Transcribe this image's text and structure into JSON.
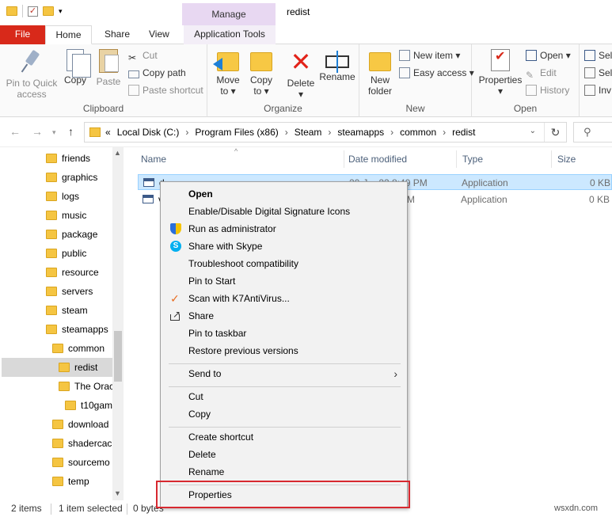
{
  "window": {
    "context_tab_header": "Manage",
    "title": "redist"
  },
  "tabs": {
    "file": "File",
    "home": "Home",
    "share": "Share",
    "view": "View",
    "app_tools": "Application Tools"
  },
  "ribbon": {
    "clipboard": {
      "label": "Clipboard",
      "pin_line1": "Pin to Quick",
      "pin_line2": "access",
      "copy": "Copy",
      "paste": "Paste",
      "cut": "Cut",
      "copy_path": "Copy path",
      "paste_shortcut": "Paste shortcut"
    },
    "organize": {
      "label": "Organize",
      "move_to_line1": "Move",
      "move_to_line2": "to ▾",
      "copy_to_line1": "Copy",
      "copy_to_line2": "to ▾",
      "delete_line1": "Delete",
      "delete_line2": "▾",
      "rename": "Rename"
    },
    "new": {
      "label": "New",
      "new_folder_line1": "New",
      "new_folder_line2": "folder",
      "new_item": "New item ▾",
      "easy_access": "Easy access ▾"
    },
    "open": {
      "label": "Open",
      "properties_line1": "Properties",
      "properties_line2": "▾",
      "open": "Open ▾",
      "edit": "Edit",
      "history": "History"
    },
    "select": {
      "select_all": "Sel",
      "select_none": "Sel",
      "invert": "Inv"
    }
  },
  "address": {
    "prefix": "«",
    "crumbs": [
      "Local Disk (C:)",
      "Program Files (x86)",
      "Steam",
      "steamapps",
      "common",
      "redist"
    ]
  },
  "navpane": {
    "items": [
      {
        "label": "friends"
      },
      {
        "label": "graphics"
      },
      {
        "label": "logs"
      },
      {
        "label": "music"
      },
      {
        "label": "package"
      },
      {
        "label": "public"
      },
      {
        "label": "resource"
      },
      {
        "label": "servers"
      },
      {
        "label": "steam"
      },
      {
        "label": "steamapps"
      },
      {
        "label": "common"
      },
      {
        "label": "redist"
      },
      {
        "label": "The Orac"
      },
      {
        "label": "t10gam"
      },
      {
        "label": "download"
      },
      {
        "label": "shadercac"
      },
      {
        "label": "sourcemo"
      },
      {
        "label": "temp"
      }
    ]
  },
  "filelist": {
    "columns": {
      "name": "Name",
      "date": "Date modified",
      "type": "Type",
      "size": "Size"
    },
    "rows": [
      {
        "name": "d",
        "date": "20-J...-22 8:49 PM",
        "type": "Application",
        "size": "0 KB"
      },
      {
        "name": "v",
        "date": "...M",
        "type": "Application",
        "size": "0 KB"
      }
    ]
  },
  "context_menu": {
    "items": {
      "open": "Open",
      "signature": "Enable/Disable Digital Signature Icons",
      "run_admin": "Run as administrator",
      "skype": "Share with Skype",
      "troubleshoot": "Troubleshoot compatibility",
      "pin_start": "Pin to Start",
      "k7": "Scan with K7AntiVirus...",
      "share": "Share",
      "pin_taskbar": "Pin to taskbar",
      "restore": "Restore previous versions",
      "send_to": "Send to",
      "cut": "Cut",
      "copy": "Copy",
      "create_shortcut": "Create shortcut",
      "delete": "Delete",
      "rename": "Rename",
      "properties": "Properties"
    },
    "icons": {
      "shield": "uac-shield-icon",
      "skype": "skype-icon",
      "k7": "k7-antivirus-icon",
      "share": "share-icon"
    }
  },
  "status": {
    "items": "2 items",
    "selected": "1 item selected",
    "size": "0 bytes"
  },
  "watermark": "wsxdn.com",
  "colors": {
    "file_tab": "#d8291a",
    "manage_tab": "#e8d8f2",
    "selection": "#cce8ff",
    "highlight_box": "#d7282f"
  }
}
